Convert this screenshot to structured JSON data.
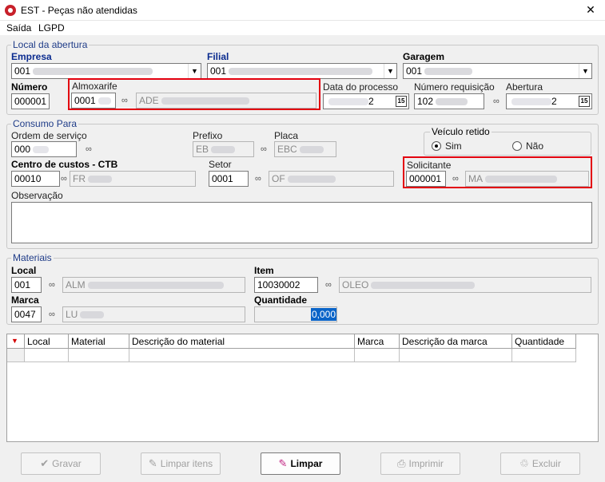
{
  "window": {
    "title": "EST - Peças não atendidas",
    "close_glyph": "✕"
  },
  "menu": [
    "Saída",
    "LGPD"
  ],
  "group_abertura": {
    "legend": "Local da abertura",
    "empresa": {
      "label": "Empresa",
      "code": "001"
    },
    "filial": {
      "label": "Filial",
      "code": "001"
    },
    "garagem": {
      "label": "Garagem",
      "code": "001"
    },
    "numero": {
      "label": "Número",
      "value": "000001"
    },
    "almoxarife": {
      "label": "Almoxarife",
      "code": "0001",
      "name": "ADE"
    },
    "data_processo": {
      "label": "Data do processo",
      "value": "2"
    },
    "numero_requisicao": {
      "label": "Número requisição",
      "value": "102"
    },
    "abertura": {
      "label": "Abertura",
      "value": "2"
    }
  },
  "group_consumo": {
    "legend": "Consumo Para",
    "ordem_servico": {
      "label": "Ordem de serviço",
      "value": "000"
    },
    "prefixo": {
      "label": "Prefixo",
      "value": "EB"
    },
    "placa": {
      "label": "Placa",
      "value": "EBC"
    },
    "veiculo_retido": {
      "label": "Veículo retido",
      "options": [
        "Sim",
        "Não"
      ],
      "selected": "Sim"
    },
    "centro_custos": {
      "label": "Centro de custos - CTB",
      "code": "00010",
      "name": "FR"
    },
    "setor": {
      "label": "Setor",
      "code": "0001",
      "name": "OF"
    },
    "solicitante": {
      "label": "Solicitante",
      "code": "000001",
      "name": "MA"
    },
    "observacao": {
      "label": "Observação",
      "value": ""
    }
  },
  "group_materiais": {
    "legend": "Materiais",
    "local": {
      "label": "Local",
      "code": "001",
      "name": "ALM"
    },
    "item": {
      "label": "Item",
      "code": "10030002",
      "name": "OLEO"
    },
    "marca": {
      "label": "Marca",
      "code": "0047",
      "name": "LU"
    },
    "quantidade": {
      "label": "Quantidade",
      "value": "0,000"
    }
  },
  "table": {
    "columns": [
      "Local",
      "Material",
      "Descrição do material",
      "Marca",
      "Descrição da marca",
      "Quantidade"
    ]
  },
  "buttons": {
    "gravar": "Gravar",
    "limpar_itens": "Limpar itens",
    "limpar": "Limpar",
    "imprimir": "Imprimir",
    "excluir": "Excluir"
  },
  "icons": {
    "binoculars": "binoculars-icon",
    "calendar": "calendar-icon",
    "dropdown": "chevron-down-icon"
  },
  "colors": {
    "highlight_box": "#e3000f",
    "app_icon": "#c8202a",
    "selection": "#0a64c8"
  }
}
